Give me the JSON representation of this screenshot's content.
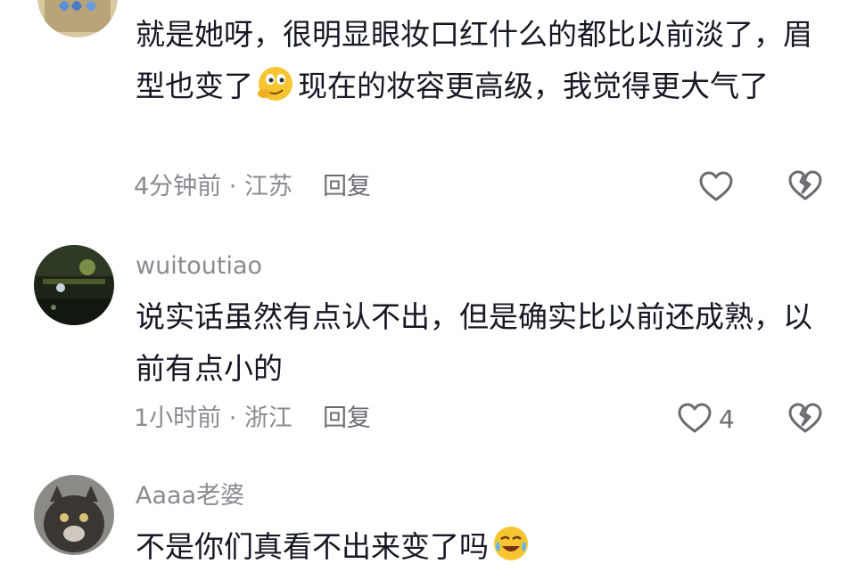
{
  "comments": [
    {
      "author": "",
      "text_before_emoji": "就是她呀，很明显眼妆口红什么的都比以前淡了，眉型也变了",
      "emoji": "thinking-face-emoji",
      "text_after_emoji": "现在的妆容更高级，我觉得更大气了",
      "time": "4分钟前",
      "location": "江苏",
      "reply_label": "回复",
      "like_count": ""
    },
    {
      "author": "wuitoutiao",
      "text": "说实话虽然有点认不出，但是确实比以前还成熟，以前有点小的",
      "time": "1小时前",
      "location": "浙江",
      "reply_label": "回复",
      "like_count": "4"
    },
    {
      "author": "Aaaa老婆",
      "text": "不是你们真看不出来变了吗",
      "emoji": "laughing-tears-emoji"
    }
  ],
  "separator": " · ",
  "icons": {
    "like": "heart-outline-icon",
    "dislike": "broken-heart-icon"
  },
  "colors": {
    "text": "#161823",
    "secondary": "#8a8b91",
    "icon": "#6b6c72"
  }
}
